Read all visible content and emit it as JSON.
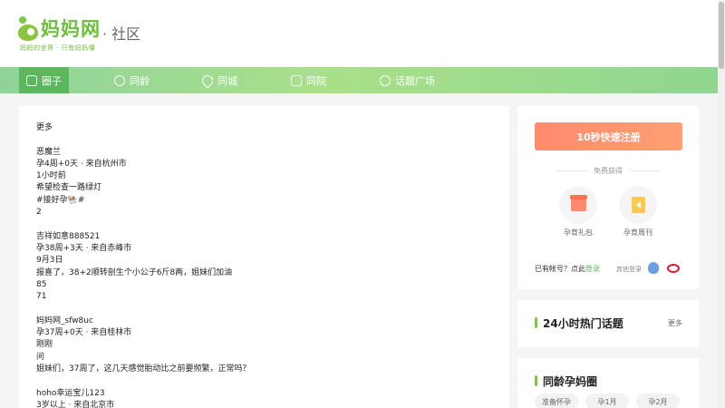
{
  "header": {
    "logo_name": "妈妈网",
    "logo_slogan": "妈妈的世界 · 只有妈妈懂",
    "section": "· 社区"
  },
  "nav": {
    "items": [
      {
        "label": "圈子",
        "icon": "chat-bubble-icon"
      },
      {
        "label": "同龄",
        "icon": "group-chat-icon"
      },
      {
        "label": "同城",
        "icon": "location-pin-icon"
      },
      {
        "label": "同院",
        "icon": "hospital-icon"
      },
      {
        "label": "话题广场",
        "icon": "hashtag-icon"
      }
    ]
  },
  "feed": {
    "more": "更多",
    "posts": [
      {
        "user": "恶魔兰",
        "meta": "孕4周+0天 · 来自杭州市",
        "time": "1小时前",
        "text": "希望检查一路绿灯",
        "tag": "#接好孕🐏#",
        "count1": "2"
      },
      {
        "user": "吉祥如意888521",
        "meta": "孕38周+3天 · 来自赤峰市",
        "time": "9月3日",
        "text": "报喜了，38+2顺转剖生个小公子6斤8两，姐妹们加油",
        "count1": "85",
        "count2": "71"
      },
      {
        "user": "妈妈网_sfw8uc",
        "meta": "孕37周+0天 · 来自桂林市",
        "time": "刚刚",
        "tag": "问",
        "text": "姐妹们，37周了，这几天感觉胎动比之前要频繁，正常吗？"
      },
      {
        "user": "hoho幸运宝儿123",
        "meta": "3岁以上 · 来自北京市"
      }
    ]
  },
  "sidebar": {
    "register_button": "10秒快速注册",
    "free_label": "免费获得",
    "gift1": "孕育礼包",
    "gift2": "孕育周刊",
    "login_prompt": "已有帐号？点此",
    "login_link": "登录",
    "other_login": "其他登录",
    "hot_title": "24小时热门话题",
    "hot_more": "更多",
    "circle_title": "同龄孕妈圈",
    "circle_tags": [
      "准备怀孕",
      "孕1月",
      "孕2月"
    ]
  },
  "colors": {
    "brand_green": "#6bbf3a",
    "nav_active": "#5cb85c",
    "register_orange": "#ff8a6e"
  }
}
